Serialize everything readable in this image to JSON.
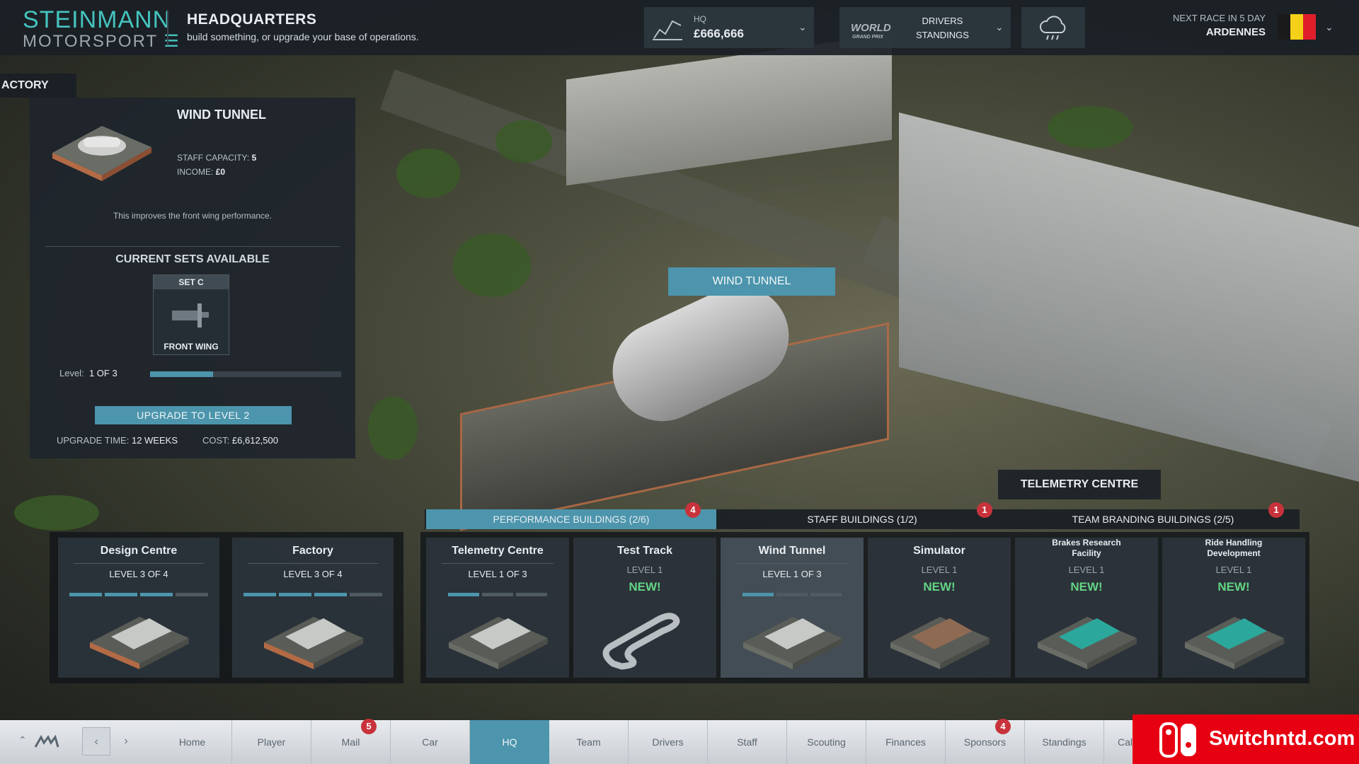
{
  "header": {
    "brand_line1": "STEINMANN",
    "brand_line2": "MOTORSPORT",
    "title": "HEADQUARTERS",
    "subtitle": "build something, or upgrade your base of operations.",
    "finance_label": "HQ",
    "finance_value": "£666,666",
    "series_logo": "WORLD GRAND PRIX",
    "standings_line1": "DRIVERS",
    "standings_line2": "STANDINGS",
    "weather_icon": "rain-cloud-icon",
    "next_race_label": "NEXT RACE IN 5 DAY",
    "next_race_location": "ARDENNES",
    "flag_colors": [
      "#1a1a1a",
      "#f5d019",
      "#e01f2b"
    ]
  },
  "left_tab": "ACTORY",
  "detail_panel": {
    "title": "WIND TUNNEL",
    "staff_capacity_label": "STAFF CAPACITY:",
    "staff_capacity_value": "5",
    "income_label": "INCOME:",
    "income_value": "£0",
    "description": "This improves the front wing performance.",
    "sets_heading": "CURRENT SETS AVAILABLE",
    "set_name": "SET C",
    "set_part": "FRONT WING",
    "level_label": "Level:",
    "level_value": "1 OF 3",
    "level_progress": 0.33,
    "upgrade_button": "UPGRADE TO LEVEL 2",
    "upgrade_time_label": "UPGRADE TIME:",
    "upgrade_time_value": "12 WEEKS",
    "cost_label": "COST:",
    "cost_value": "£6,612,500"
  },
  "map_labels": {
    "wind_tunnel": "WIND TUNNEL",
    "telemetry_centre": "TELEMETRY CENTRE"
  },
  "categories": [
    {
      "label": "PERFORMANCE BUILDINGS (2/6)",
      "badge": "4",
      "active": true
    },
    {
      "label": "STAFF BUILDINGS (1/2)",
      "badge": "1",
      "active": false
    },
    {
      "label": "TEAM BRANDING BUILDINGS (2/5)",
      "badge": "1",
      "active": false
    }
  ],
  "factory_buildings": [
    {
      "name": "Design Centre",
      "level": "LEVEL 3 OF 4",
      "segments": 4,
      "filled": 3
    },
    {
      "name": "Factory",
      "level": "LEVEL 3 OF 4",
      "segments": 4,
      "filled": 3
    }
  ],
  "performance_buildings": [
    {
      "name": "Telemetry Centre",
      "level": "LEVEL 1 OF 3",
      "segments": 3,
      "filled": 1,
      "new": ""
    },
    {
      "name": "Test Track",
      "level": "LEVEL 1",
      "segments": 0,
      "filled": 0,
      "new": "NEW!"
    },
    {
      "name": "Wind Tunnel",
      "level": "LEVEL 1 OF 3",
      "segments": 3,
      "filled": 1,
      "new": "",
      "selected": true
    },
    {
      "name": "Simulator",
      "level": "LEVEL 1",
      "segments": 0,
      "filled": 0,
      "new": "NEW!"
    },
    {
      "name": "Brakes Research Facility",
      "level": "LEVEL 1",
      "segments": 0,
      "filled": 0,
      "new": "NEW!"
    },
    {
      "name": "Ride Handling Development",
      "level": "LEVEL 1",
      "segments": 0,
      "filled": 0,
      "new": "NEW!"
    }
  ],
  "nav": {
    "items": [
      {
        "label": "Home",
        "badge": ""
      },
      {
        "label": "Player",
        "badge": ""
      },
      {
        "label": "Mail",
        "badge": "5"
      },
      {
        "label": "Car",
        "badge": ""
      },
      {
        "label": "HQ",
        "badge": "",
        "active": true
      },
      {
        "label": "Team",
        "badge": ""
      },
      {
        "label": "Drivers",
        "badge": ""
      },
      {
        "label": "Staff",
        "badge": ""
      },
      {
        "label": "Scouting",
        "badge": ""
      },
      {
        "label": "Finances",
        "badge": ""
      },
      {
        "label": "Sponsors",
        "badge": "4"
      },
      {
        "label": "Standings",
        "badge": ""
      },
      {
        "label": "Cal",
        "badge": ""
      }
    ]
  },
  "watermark": "Switchntd.com",
  "colors": {
    "accent": "#4c95ad",
    "brand": "#45c4bf",
    "badge": "#c8333b",
    "new": "#63d484"
  }
}
